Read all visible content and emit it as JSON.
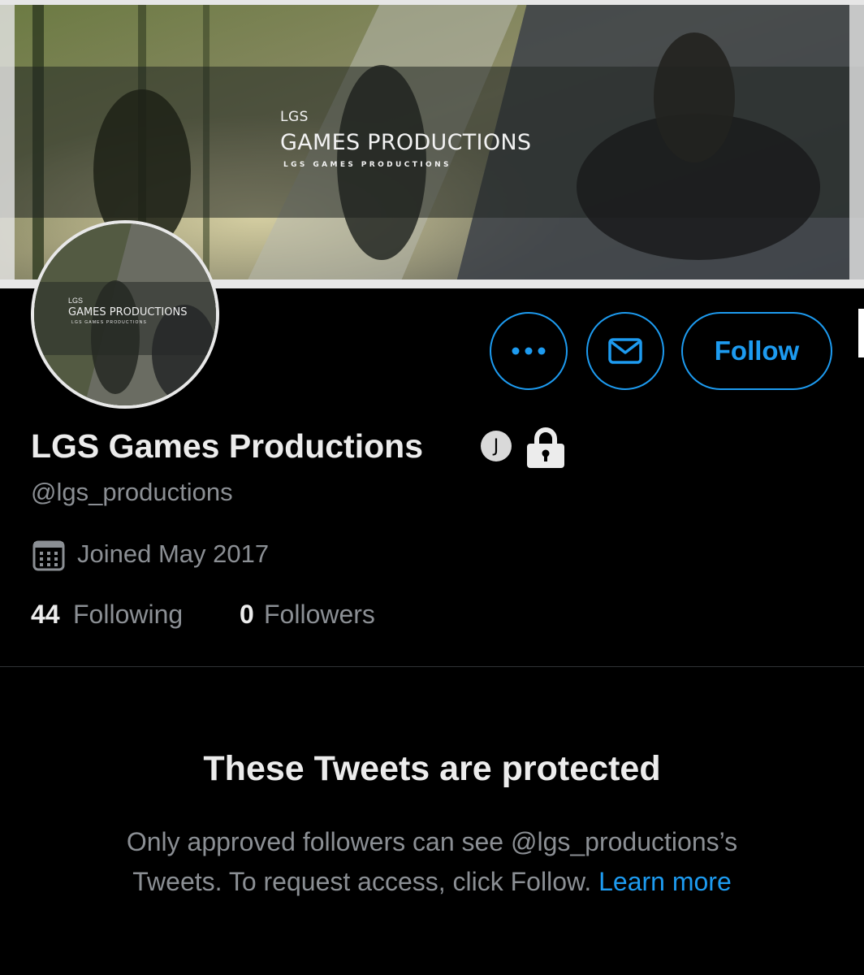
{
  "banner": {
    "small_text": "LGS",
    "big_text": "GAMES PRODUCTIONS",
    "tiny_text": "LGS GAMES PRODUCTIONS"
  },
  "avatar": {
    "small_text": "LGS",
    "big_text": "GAMES PRODUCTIONS",
    "tiny_text": "LGS GAMES PRODUCTIONS"
  },
  "actions": {
    "more_label": "•••",
    "follow_label": "Follow"
  },
  "profile": {
    "display_name": "LGS Games Productions",
    "badge_letter": "J",
    "handle": "@lgs_productions",
    "joined": "Joined May 2017",
    "following_count": "44",
    "following_label": "Following",
    "followers_count": "0",
    "followers_label": "Followers"
  },
  "protected": {
    "title": "These Tweets are protected",
    "line1": "Only approved followers can see @lgs_productions’s",
    "line2": "Tweets. To request access, click Follow.",
    "learn_more": "Learn more"
  },
  "colors": {
    "accent": "#1d9bf0",
    "background": "#000000",
    "secondary_text": "#8b8f94"
  },
  "icons": [
    "more-icon",
    "mail-icon",
    "lock-icon",
    "calendar-icon"
  ]
}
